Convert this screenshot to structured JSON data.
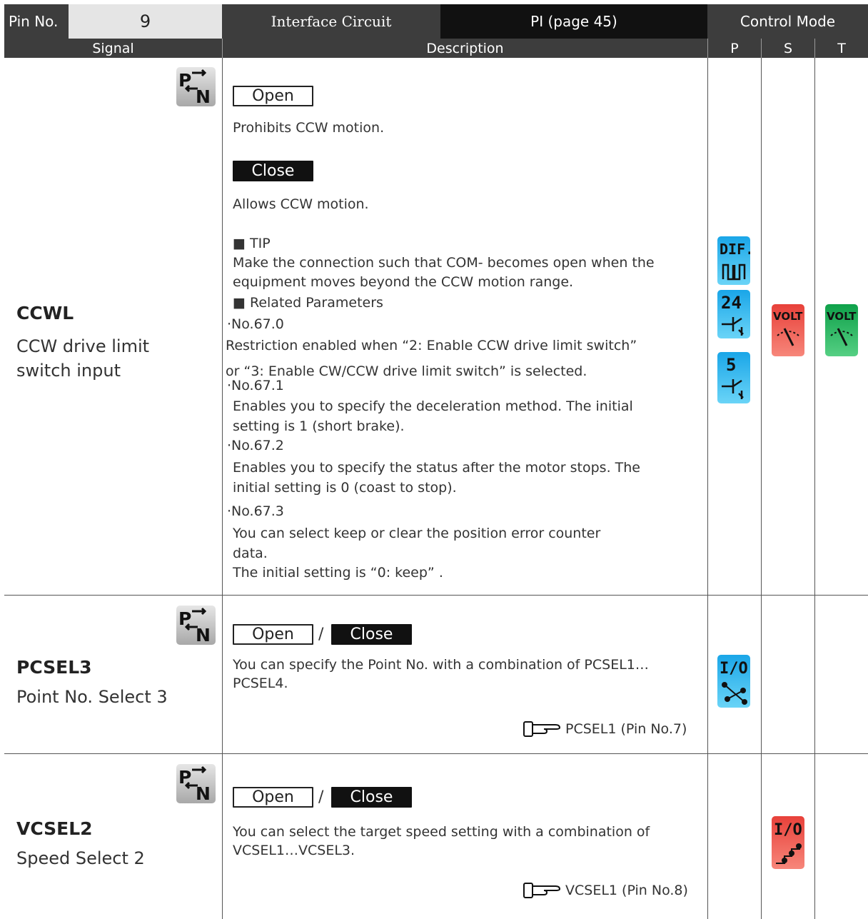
{
  "header": {
    "pin_label": "Pin No.",
    "pin_value": "9",
    "interface_label": "Interface Circuit",
    "interface_value": "PI (page 45)",
    "control_mode": "Control Mode"
  },
  "subheader": {
    "signal": "Signal",
    "description": "Description",
    "p": "P",
    "s": "S",
    "t": "T"
  },
  "rows": [
    {
      "signal_name": "CCWL",
      "signal_desc_1": "CCW drive limit",
      "signal_desc_2": "switch input",
      "open_label": "Open",
      "open_text": "Prohibits CCW motion.",
      "close_label": "Close",
      "close_text": "Allows CCW motion.",
      "tip_heading": "■ TIP",
      "tip_line_1": "Make the connection such that COM- becomes open when the",
      "tip_line_2": "equipment moves beyond the CCW motion range.",
      "related_heading": "■ Related Parameters",
      "p670": "·No.67.0",
      "p670_line_1": "Restriction enabled when “2: Enable CCW drive limit switch”",
      "p670_line_2": "or “3: Enable CW/CCW drive limit switch” is selected.",
      "p671": "·No.67.1",
      "p671_line_1": "Enables you to specify the deceleration method. The initial",
      "p671_line_2": "setting is 1 (short brake).",
      "p672": "·No.67.2",
      "p672_line_1": "Enables you to specify the status after the motor stops. The",
      "p672_line_2": "initial setting is 0 (coast to stop).",
      "p673": "·No.67.3",
      "p673_line_1": "You can select keep or clear the position error counter",
      "p673_line_2": "data.",
      "p673_line_3": "The initial setting is “0: keep” ."
    },
    {
      "signal_name": "PCSEL3",
      "signal_desc": "Point No. Select 3",
      "open_label": "Open",
      "slash": "/",
      "close_label": "Close",
      "line_1": "You can specify the Point No. with a combination of PCSEL1…",
      "line_2": "PCSEL4.",
      "ref": "PCSEL1 (Pin No.7)"
    },
    {
      "signal_name": "VCSEL2",
      "signal_desc": "Speed Select 2",
      "open_label": "Open",
      "slash": "/",
      "close_label": "Close",
      "line_1": "You can select the target speed setting with a combination of",
      "line_2": "VCSEL1…VCSEL3.",
      "ref": "VCSEL1 (Pin No.8)"
    }
  ],
  "icons": {
    "dif": "DIF.",
    "v24": "24",
    "v5": "5",
    "volt": "VOLT",
    "io": "I/O"
  },
  "colors": {
    "header_dark": "#3d3d3d",
    "header_black": "#111111",
    "pin_cell": "#e5e5e5",
    "blue_icon": "#1aa6e8",
    "red_icon": "#e8413a",
    "green_icon": "#0fa14a"
  }
}
